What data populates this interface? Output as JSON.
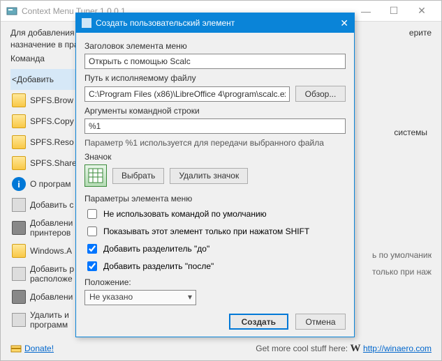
{
  "main": {
    "title": "Context Menu Tuner 1.0.0.1",
    "instr_line1": "Для добавления нс",
    "instr_line2": "назначение в прав",
    "instr_tail": "ерите",
    "command_label": "Команда",
    "right_tail": "системы"
  },
  "sidebar": {
    "items": [
      {
        "label": "<Добавить"
      },
      {
        "label": "SPFS.Brow"
      },
      {
        "label": "SPFS.Copy"
      },
      {
        "label": "SPFS.Reso"
      },
      {
        "label": "SPFS.Share"
      },
      {
        "label": "О програм"
      },
      {
        "label": "Добавить с"
      },
      {
        "label": "Добавлени"
      },
      {
        "label2": "принтеров"
      },
      {
        "label": "Windows.A"
      },
      {
        "label": "Добавить р"
      },
      {
        "label2": "расположе"
      },
      {
        "label": "Добавлени"
      },
      {
        "label": "Удалить и"
      },
      {
        "label2": "программ"
      }
    ]
  },
  "right": {
    "items": [
      "ь по умолчанию",
      "только при нажат",
      "",
      ""
    ]
  },
  "footer": {
    "donate": "Donate!",
    "more": "Get more cool stuff here:",
    "url": "http://winaero.com"
  },
  "dialog": {
    "title": "Создать пользовательский элемент",
    "menu_title_label": "Заголовок элемента меню",
    "menu_title_value": "Открыть с помощью Scalc",
    "exe_label": "Путь к исполняемому файлу",
    "exe_value": "C:\\Program Files (x86)\\LibreOffice 4\\program\\scalc.exe",
    "browse": "Обзор...",
    "args_label": "Аргументы командной строки",
    "args_value": "%1",
    "args_hint": "Параметр %1 используется для передачи выбранного файла",
    "icon_label": "Значок",
    "choose": "Выбрать",
    "remove_icon": "Удалить значок",
    "params_label": "Параметры элемента меню",
    "cb1": "Не использовать командой по умолчанию",
    "cb2": "Показывать этот элемент только при нажатом SHIFT",
    "cb3": "Добавить разделитель \"до\"",
    "cb4": "Добавить разделить \"после\"",
    "pos_label": "Положение:",
    "pos_value": "Не указано",
    "create": "Создать",
    "cancel": "Отмена"
  }
}
